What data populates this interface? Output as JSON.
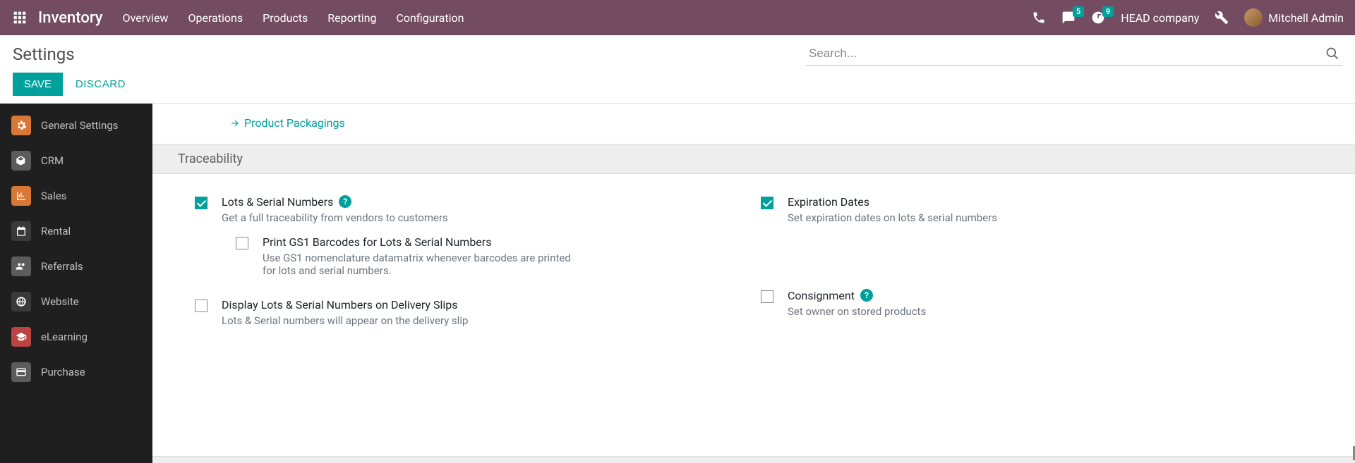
{
  "topnav": {
    "brand": "Inventory",
    "menu": [
      "Overview",
      "Operations",
      "Products",
      "Reporting",
      "Configuration"
    ],
    "messages_badge": "5",
    "activities_badge": "9",
    "company": "HEAD company",
    "user": "Mitchell Admin"
  },
  "control_panel": {
    "title": "Settings",
    "search_placeholder": "Search...",
    "save": "SAVE",
    "discard": "DISCARD"
  },
  "sidebar": {
    "items": [
      {
        "label": "General Settings"
      },
      {
        "label": "CRM"
      },
      {
        "label": "Sales"
      },
      {
        "label": "Rental"
      },
      {
        "label": "Referrals"
      },
      {
        "label": "Website"
      },
      {
        "label": "eLearning"
      },
      {
        "label": "Purchase"
      }
    ]
  },
  "content": {
    "link": "Product Packagings",
    "section": "Traceability",
    "lots": {
      "title": "Lots & Serial Numbers",
      "desc": "Get a full traceability from vendors to customers",
      "checked": true,
      "sub": {
        "title": "Print GS1 Barcodes for Lots & Serial Numbers",
        "desc": "Use GS1 nomenclature datamatrix whenever barcodes are printed for lots and serial numbers.",
        "checked": false
      }
    },
    "display_lots": {
      "title": "Display Lots & Serial Numbers on Delivery Slips",
      "desc": "Lots & Serial numbers will appear on the delivery slip",
      "checked": false
    },
    "expiration": {
      "title": "Expiration Dates",
      "desc": "Set expiration dates on lots & serial numbers",
      "checked": true
    },
    "consignment": {
      "title": "Consignment",
      "desc": "Set owner on stored products",
      "checked": false
    }
  }
}
